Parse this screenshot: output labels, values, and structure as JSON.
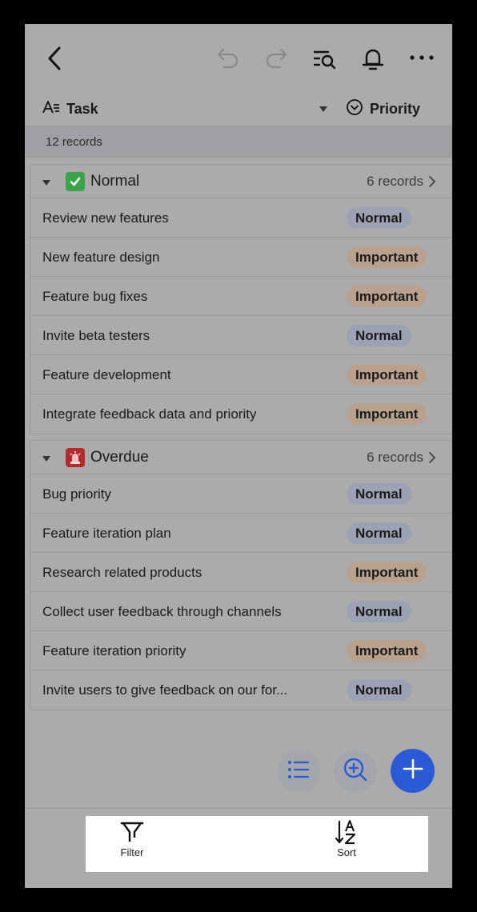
{
  "header": {
    "icons": [
      "back-icon",
      "undo-icon",
      "redo-icon",
      "search-records-icon",
      "bell-icon",
      "more-icon"
    ]
  },
  "columns": {
    "task_label": "Task",
    "priority_label": "Priority"
  },
  "summary": {
    "records_text": "12 records"
  },
  "groups": [
    {
      "name": "Normal",
      "emoji": "✅",
      "count_text": "6 records",
      "rows": [
        {
          "task": "Review new features",
          "priority": "Normal"
        },
        {
          "task": "New feature design",
          "priority": "Important"
        },
        {
          "task": "Feature bug fixes",
          "priority": "Important"
        },
        {
          "task": "Invite beta testers",
          "priority": "Normal"
        },
        {
          "task": "Feature development",
          "priority": "Important"
        },
        {
          "task": "Integrate feedback data and priority",
          "priority": "Important"
        }
      ]
    },
    {
      "name": "Overdue",
      "emoji": "🚨",
      "count_text": "6 records",
      "rows": [
        {
          "task": "Bug priority",
          "priority": "Normal"
        },
        {
          "task": "Feature iteration plan",
          "priority": "Normal"
        },
        {
          "task": "Research related products",
          "priority": "Important"
        },
        {
          "task": "Collect user feedback through channels",
          "priority": "Normal"
        },
        {
          "task": "Feature iteration priority",
          "priority": "Important"
        },
        {
          "task": "Invite users to give feedback on our for...",
          "priority": "Normal"
        }
      ]
    }
  ],
  "sheet": {
    "filter_label": "Filter",
    "sort_label": "Sort"
  },
  "colors": {
    "accent": "#2a5ad6",
    "normal_tag": "#9ba2b3",
    "important_tag": "#b8a28d"
  }
}
